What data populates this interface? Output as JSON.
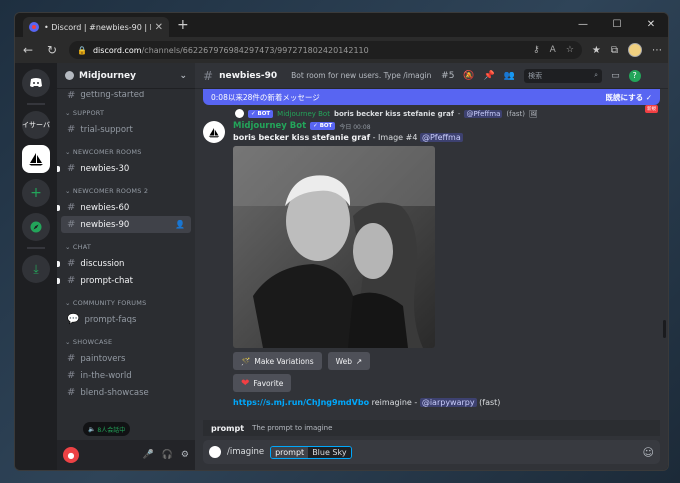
{
  "browser": {
    "tab_title": "• Discord | #newbies-90 | Midjou",
    "url_host": "discord.com",
    "url_path": "/channels/662267976984297473/997271802420142110"
  },
  "servers": {
    "text_server_label": "イサーバ"
  },
  "guild": {
    "name": "Midjourney"
  },
  "sidebar": {
    "top_partial": "getting-started",
    "categories": {
      "support": "SUPPORT",
      "newcomer1": "NEWCOMER ROOMS",
      "newcomer2": "NEWCOMER ROOMS 2",
      "chat": "CHAT",
      "community": "COMMUNITY FORUMS",
      "showcase": "SHOWCASE"
    },
    "channels": {
      "trial_support": "trial-support",
      "newbies30": "newbies-30",
      "newbies60": "newbies-60",
      "newbies90": "newbies-90",
      "discussion": "discussion",
      "prompt_chat": "prompt-chat",
      "prompt_faqs": "prompt-faqs",
      "paintovers": "paintovers",
      "in_the_world": "in-the-world",
      "blend_showcase": "blend-showcase"
    },
    "voice_badge": "8人会話中"
  },
  "header": {
    "channel": "newbies-90",
    "topic": "Bot room for new users. Type /imagin...",
    "thread_count": "5",
    "search_placeholder": "検索"
  },
  "banner": {
    "text": "0:08以来28件の新着メッセージ",
    "action": "既読にする"
  },
  "new_tag": "新規",
  "reply": {
    "bot": "BOT",
    "name": "Midjourney Bot",
    "text": "boris becker kiss stefanie graf",
    "mention": "@Pfeffma",
    "speed": "(fast)"
  },
  "message": {
    "author": "Midjourney Bot",
    "bot": "BOT",
    "time": "今日 00:08",
    "prompt": "boris becker kiss stefanie graf",
    "suffix": " - Image #4 ",
    "mention": "@Pfeffma"
  },
  "buttons": {
    "variations": "Make Variations",
    "web": "Web",
    "favorite": "Favorite"
  },
  "link": {
    "url": "https://s.mj.run/ChJng9mdVbo",
    "text": " reimagine - ",
    "mention": "@iarpywarpy",
    "speed": "(fast)"
  },
  "option_hint": {
    "key": "prompt",
    "desc": "The prompt to imagine"
  },
  "composer": {
    "command": "/imagine",
    "option_name": "prompt",
    "option_value": "Blue Sky"
  }
}
